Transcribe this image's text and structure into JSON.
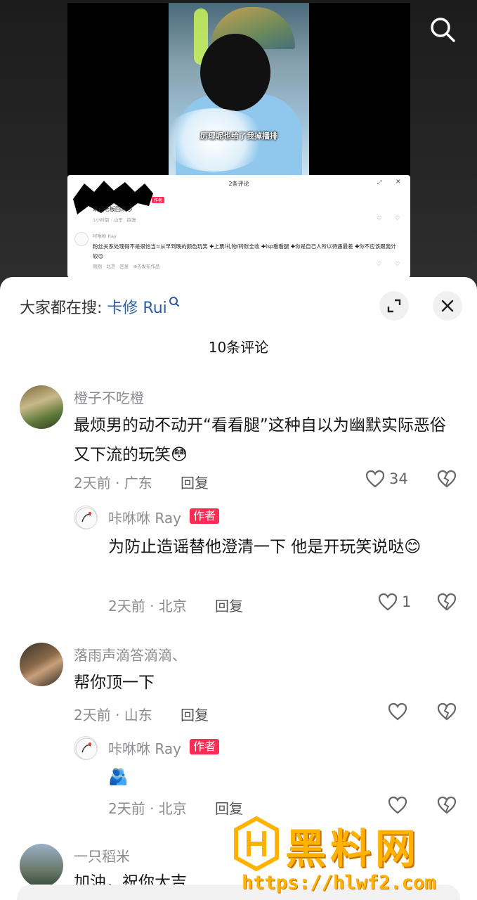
{
  "video": {
    "caption": "厉理呢也给了我掉播排"
  },
  "embedded_card": {
    "title": "2条评论",
    "comment1": {
      "author_tag": "作者",
      "text": "欢迎老板回来🐱",
      "meta": "1小时前 · 山东",
      "reply": "回复"
    },
    "comment2": {
      "username": "咔咻咻 Ray",
      "text": "粉丝关系处理得不是很恰当=从早到晚的颜色玩笑 ✚上票/礼物/转账全收 ✚lsp看看腿 ✚你是自己人所以待遇最差 ✚你不应该跟我计较😊",
      "meta": "刚刚 · 北京",
      "reply": "回复",
      "share": "⊕去发布作品"
    }
  },
  "sheet": {
    "search_prefix": "大家都在搜:",
    "search_keyword": "卡修 Rui",
    "title": "10条评论",
    "comments": [
      {
        "username": "橙子不吃橙",
        "text": "最烦男的动不动开“看看腿”这种自以为幽默实际恶俗又下流的玩笑😳",
        "meta": "2天前 · 广东",
        "reply": "回复",
        "likes": "34",
        "reply_item": {
          "username": "咔咻咻 Ray",
          "author_tag": "作者",
          "text": "为防止造谣替他澄清一下 他是开玩笑说哒😊",
          "meta": "2天前 · 北京",
          "reply": "回复",
          "likes": "1"
        }
      },
      {
        "username": "落雨声滴答滴滴、",
        "text": "帮你顶一下",
        "meta": "2天前 · 山东",
        "reply": "回复",
        "reply_item": {
          "username": "咔咻咻 Ray",
          "author_tag": "作者",
          "text": "🫂",
          "meta": "2天前 · 北京",
          "reply": "回复"
        }
      },
      {
        "username": "一只稻米",
        "text": "加油，祝你大吉"
      }
    ]
  },
  "watermark": {
    "text": "黑料网",
    "url": "https://hlwf2.com"
  },
  "colors": {
    "accent_pink": "#fe2c55",
    "keyword_blue": "#2d5fa3",
    "watermark_orange": "#ffb300"
  }
}
